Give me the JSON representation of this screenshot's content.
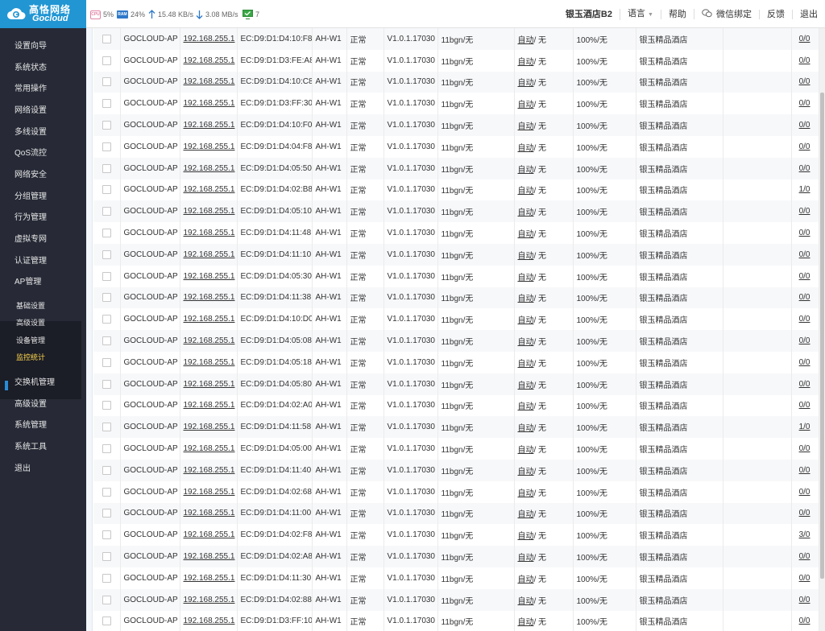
{
  "brand": {
    "name_cn": "高恪网络",
    "name_en": "Gocloud"
  },
  "status": {
    "cpu_icon": "CPU",
    "cpu": "5%",
    "ram_icon": "RAM",
    "ram": "24%",
    "upload": "15.48 KB/s",
    "download": "3.08 MB/s",
    "online_count": "7"
  },
  "topnav": {
    "hotel": "银玉酒店B2",
    "language": "语言",
    "help": "帮助",
    "wechat": "微信绑定",
    "feedback": "反馈",
    "logout": "退出"
  },
  "sidebar": {
    "items": [
      "设置向导",
      "系统状态",
      "常用操作",
      "网络设置",
      "多线设置",
      "QoS流控",
      "网络安全",
      "分组管理",
      "行为管理",
      "虚拟专网",
      "认证管理",
      "AP管理"
    ],
    "ap_submenu": [
      "基础设置",
      "高级设置",
      "设备管理",
      "监控统计"
    ],
    "items_after": [
      "交换机管理",
      "高级设置",
      "系统管理",
      "系统工具",
      "退出"
    ]
  },
  "table": {
    "rows": [
      {
        "name": "GOCLOUD-AP",
        "ip": "192.168.255.1",
        "mac": "EC:D9:D1:D4:10:F8",
        "model": "AH-W1",
        "status": "正常",
        "version": "V1.0.1.17030",
        "mode": "11bgn/无",
        "channel_link": "自动",
        "channel_rest": "/ 无",
        "power": "100%/无",
        "group": "银玉精品酒店",
        "clients": "0/0"
      },
      {
        "name": "GOCLOUD-AP",
        "ip": "192.168.255.1",
        "mac": "EC:D9:D1:D3:FE:A8",
        "model": "AH-W1",
        "status": "正常",
        "version": "V1.0.1.17030",
        "mode": "11bgn/无",
        "channel_link": "自动",
        "channel_rest": "/ 无",
        "power": "100%/无",
        "group": "银玉精品酒店",
        "clients": "0/0"
      },
      {
        "name": "GOCLOUD-AP",
        "ip": "192.168.255.1",
        "mac": "EC:D9:D1:D4:10:C8",
        "model": "AH-W1",
        "status": "正常",
        "version": "V1.0.1.17030",
        "mode": "11bgn/无",
        "channel_link": "自动",
        "channel_rest": "/ 无",
        "power": "100%/无",
        "group": "银玉精品酒店",
        "clients": "0/0"
      },
      {
        "name": "GOCLOUD-AP",
        "ip": "192.168.255.1",
        "mac": "EC:D9:D1:D3:FF:30",
        "model": "AH-W1",
        "status": "正常",
        "version": "V1.0.1.17030",
        "mode": "11bgn/无",
        "channel_link": "自动",
        "channel_rest": "/ 无",
        "power": "100%/无",
        "group": "银玉精品酒店",
        "clients": "0/0"
      },
      {
        "name": "GOCLOUD-AP",
        "ip": "192.168.255.1",
        "mac": "EC:D9:D1:D4:10:F0",
        "model": "AH-W1",
        "status": "正常",
        "version": "V1.0.1.17030",
        "mode": "11bgn/无",
        "channel_link": "自动",
        "channel_rest": "/ 无",
        "power": "100%/无",
        "group": "银玉精品酒店",
        "clients": "0/0"
      },
      {
        "name": "GOCLOUD-AP",
        "ip": "192.168.255.1",
        "mac": "EC:D9:D1:D4:04:F8",
        "model": "AH-W1",
        "status": "正常",
        "version": "V1.0.1.17030",
        "mode": "11bgn/无",
        "channel_link": "自动",
        "channel_rest": "/ 无",
        "power": "100%/无",
        "group": "银玉精品酒店",
        "clients": "0/0"
      },
      {
        "name": "GOCLOUD-AP",
        "ip": "192.168.255.1",
        "mac": "EC:D9:D1:D4:05:50",
        "model": "AH-W1",
        "status": "正常",
        "version": "V1.0.1.17030",
        "mode": "11bgn/无",
        "channel_link": "自动",
        "channel_rest": "/ 无",
        "power": "100%/无",
        "group": "银玉精品酒店",
        "clients": "0/0"
      },
      {
        "name": "GOCLOUD-AP",
        "ip": "192.168.255.1",
        "mac": "EC:D9:D1:D4:02:B8",
        "model": "AH-W1",
        "status": "正常",
        "version": "V1.0.1.17030",
        "mode": "11bgn/无",
        "channel_link": "自动",
        "channel_rest": "/ 无",
        "power": "100%/无",
        "group": "银玉精品酒店",
        "clients": "1/0"
      },
      {
        "name": "GOCLOUD-AP",
        "ip": "192.168.255.1",
        "mac": "EC:D9:D1:D4:05:10",
        "model": "AH-W1",
        "status": "正常",
        "version": "V1.0.1.17030",
        "mode": "11bgn/无",
        "channel_link": "自动",
        "channel_rest": "/ 无",
        "power": "100%/无",
        "group": "银玉精品酒店",
        "clients": "0/0"
      },
      {
        "name": "GOCLOUD-AP",
        "ip": "192.168.255.1",
        "mac": "EC:D9:D1:D4:11:48",
        "model": "AH-W1",
        "status": "正常",
        "version": "V1.0.1.17030",
        "mode": "11bgn/无",
        "channel_link": "自动",
        "channel_rest": "/ 无",
        "power": "100%/无",
        "group": "银玉精品酒店",
        "clients": "0/0"
      },
      {
        "name": "GOCLOUD-AP",
        "ip": "192.168.255.1",
        "mac": "EC:D9:D1:D4:11:10",
        "model": "AH-W1",
        "status": "正常",
        "version": "V1.0.1.17030",
        "mode": "11bgn/无",
        "channel_link": "自动",
        "channel_rest": "/ 无",
        "power": "100%/无",
        "group": "银玉精品酒店",
        "clients": "0/0"
      },
      {
        "name": "GOCLOUD-AP",
        "ip": "192.168.255.1",
        "mac": "EC:D9:D1:D4:05:30",
        "model": "AH-W1",
        "status": "正常",
        "version": "V1.0.1.17030",
        "mode": "11bgn/无",
        "channel_link": "自动",
        "channel_rest": "/ 无",
        "power": "100%/无",
        "group": "银玉精品酒店",
        "clients": "0/0"
      },
      {
        "name": "GOCLOUD-AP",
        "ip": "192.168.255.1",
        "mac": "EC:D9:D1:D4:11:38",
        "model": "AH-W1",
        "status": "正常",
        "version": "V1.0.1.17030",
        "mode": "11bgn/无",
        "channel_link": "自动",
        "channel_rest": "/ 无",
        "power": "100%/无",
        "group": "银玉精品酒店",
        "clients": "0/0"
      },
      {
        "name": "GOCLOUD-AP",
        "ip": "192.168.255.1",
        "mac": "EC:D9:D1:D4:10:D0",
        "model": "AH-W1",
        "status": "正常",
        "version": "V1.0.1.17030",
        "mode": "11bgn/无",
        "channel_link": "自动",
        "channel_rest": "/ 无",
        "power": "100%/无",
        "group": "银玉精品酒店",
        "clients": "0/0"
      },
      {
        "name": "GOCLOUD-AP",
        "ip": "192.168.255.1",
        "mac": "EC:D9:D1:D4:05:08",
        "model": "AH-W1",
        "status": "正常",
        "version": "V1.0.1.17030",
        "mode": "11bgn/无",
        "channel_link": "自动",
        "channel_rest": "/ 无",
        "power": "100%/无",
        "group": "银玉精品酒店",
        "clients": "0/0"
      },
      {
        "name": "GOCLOUD-AP",
        "ip": "192.168.255.1",
        "mac": "EC:D9:D1:D4:05:18",
        "model": "AH-W1",
        "status": "正常",
        "version": "V1.0.1.17030",
        "mode": "11bgn/无",
        "channel_link": "自动",
        "channel_rest": "/ 无",
        "power": "100%/无",
        "group": "银玉精品酒店",
        "clients": "0/0"
      },
      {
        "name": "GOCLOUD-AP",
        "ip": "192.168.255.1",
        "mac": "EC:D9:D1:D4:05:80",
        "model": "AH-W1",
        "status": "正常",
        "version": "V1.0.1.17030",
        "mode": "11bgn/无",
        "channel_link": "自动",
        "channel_rest": "/ 无",
        "power": "100%/无",
        "group": "银玉精品酒店",
        "clients": "0/0"
      },
      {
        "name": "GOCLOUD-AP",
        "ip": "192.168.255.1",
        "mac": "EC:D9:D1:D4:02:A0",
        "model": "AH-W1",
        "status": "正常",
        "version": "V1.0.1.17030",
        "mode": "11bgn/无",
        "channel_link": "自动",
        "channel_rest": "/ 无",
        "power": "100%/无",
        "group": "银玉精品酒店",
        "clients": "0/0"
      },
      {
        "name": "GOCLOUD-AP",
        "ip": "192.168.255.1",
        "mac": "EC:D9:D1:D4:11:58",
        "model": "AH-W1",
        "status": "正常",
        "version": "V1.0.1.17030",
        "mode": "11bgn/无",
        "channel_link": "自动",
        "channel_rest": "/ 无",
        "power": "100%/无",
        "group": "银玉精品酒店",
        "clients": "1/0"
      },
      {
        "name": "GOCLOUD-AP",
        "ip": "192.168.255.1",
        "mac": "EC:D9:D1:D4:05:00",
        "model": "AH-W1",
        "status": "正常",
        "version": "V1.0.1.17030",
        "mode": "11bgn/无",
        "channel_link": "自动",
        "channel_rest": "/ 无",
        "power": "100%/无",
        "group": "银玉精品酒店",
        "clients": "0/0"
      },
      {
        "name": "GOCLOUD-AP",
        "ip": "192.168.255.1",
        "mac": "EC:D9:D1:D4:11:40",
        "model": "AH-W1",
        "status": "正常",
        "version": "V1.0.1.17030",
        "mode": "11bgn/无",
        "channel_link": "自动",
        "channel_rest": "/ 无",
        "power": "100%/无",
        "group": "银玉精品酒店",
        "clients": "0/0"
      },
      {
        "name": "GOCLOUD-AP",
        "ip": "192.168.255.1",
        "mac": "EC:D9:D1:D4:02:68",
        "model": "AH-W1",
        "status": "正常",
        "version": "V1.0.1.17030",
        "mode": "11bgn/无",
        "channel_link": "自动",
        "channel_rest": "/ 无",
        "power": "100%/无",
        "group": "银玉精品酒店",
        "clients": "0/0"
      },
      {
        "name": "GOCLOUD-AP",
        "ip": "192.168.255.1",
        "mac": "EC:D9:D1:D4:11:00",
        "model": "AH-W1",
        "status": "正常",
        "version": "V1.0.1.17030",
        "mode": "11bgn/无",
        "channel_link": "自动",
        "channel_rest": "/ 无",
        "power": "100%/无",
        "group": "银玉精品酒店",
        "clients": "0/0"
      },
      {
        "name": "GOCLOUD-AP",
        "ip": "192.168.255.1",
        "mac": "EC:D9:D1:D4:02:F8",
        "model": "AH-W1",
        "status": "正常",
        "version": "V1.0.1.17030",
        "mode": "11bgn/无",
        "channel_link": "自动",
        "channel_rest": "/ 无",
        "power": "100%/无",
        "group": "银玉精品酒店",
        "clients": "3/0"
      },
      {
        "name": "GOCLOUD-AP",
        "ip": "192.168.255.1",
        "mac": "EC:D9:D1:D4:02:A8",
        "model": "AH-W1",
        "status": "正常",
        "version": "V1.0.1.17030",
        "mode": "11bgn/无",
        "channel_link": "自动",
        "channel_rest": "/ 无",
        "power": "100%/无",
        "group": "银玉精品酒店",
        "clients": "0/0"
      },
      {
        "name": "GOCLOUD-AP",
        "ip": "192.168.255.1",
        "mac": "EC:D9:D1:D4:11:30",
        "model": "AH-W1",
        "status": "正常",
        "version": "V1.0.1.17030",
        "mode": "11bgn/无",
        "channel_link": "自动",
        "channel_rest": "/ 无",
        "power": "100%/无",
        "group": "银玉精品酒店",
        "clients": "0/0"
      },
      {
        "name": "GOCLOUD-AP",
        "ip": "192.168.255.1",
        "mac": "EC:D9:D1:D4:02:88",
        "model": "AH-W1",
        "status": "正常",
        "version": "V1.0.1.17030",
        "mode": "11bgn/无",
        "channel_link": "自动",
        "channel_rest": "/ 无",
        "power": "100%/无",
        "group": "银玉精品酒店",
        "clients": "0/0"
      },
      {
        "name": "GOCLOUD-AP",
        "ip": "192.168.255.1",
        "mac": "EC:D9:D1:D3:FF:10",
        "model": "AH-W1",
        "status": "正常",
        "version": "V1.0.1.17030",
        "mode": "11bgn/无",
        "channel_link": "自动",
        "channel_rest": "/ 无",
        "power": "100%/无",
        "group": "银玉精品酒店",
        "clients": "0/0"
      }
    ]
  },
  "colors": {
    "brand_blue": "#2196d3",
    "sidebar_bg": "#272a36",
    "submenu_bg": "#1b1d27",
    "active_text": "#ffd84d",
    "active_marker": "#2a8cd6"
  }
}
